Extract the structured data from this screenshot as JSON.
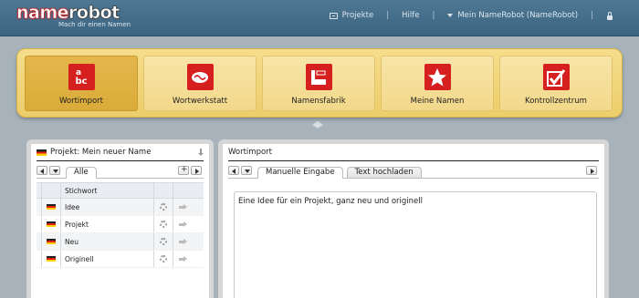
{
  "header": {
    "logo_name": "name",
    "logo_robot": "robot",
    "logo_tagline": "Mach dir einen Namen",
    "nav": [
      {
        "label": "Projekte",
        "icon": "projects-icon"
      },
      {
        "label": "Hilfe"
      },
      {
        "label": "Mein NameRobot (NameRobot)",
        "icon": "caret-down-icon"
      }
    ],
    "lock_icon": "lock-icon"
  },
  "modules": [
    {
      "label": "Wortimport",
      "icon": "abc-icon",
      "active": true,
      "icon_text_1": "a",
      "icon_text_2": "bc"
    },
    {
      "label": "Wortwerkstatt",
      "icon": "workshop-icon",
      "active": false
    },
    {
      "label": "Namensfabrik",
      "icon": "factory-icon",
      "active": false
    },
    {
      "label": "Meine Namen",
      "icon": "star-icon",
      "active": false
    },
    {
      "label": "Kontrollzentrum",
      "icon": "checkmark-icon",
      "active": false
    }
  ],
  "left_panel": {
    "title": "Projekt: Mein neuer Name",
    "tabs": [
      {
        "label": "Alle"
      }
    ],
    "column_header": "Stichwort",
    "rows": [
      {
        "word": "Idee"
      },
      {
        "word": "Projekt"
      },
      {
        "word": "Neu"
      },
      {
        "word": "Originell"
      }
    ]
  },
  "right_panel": {
    "title": "Wortimport",
    "tabs": [
      {
        "label": "Manuelle Eingabe",
        "active": true
      },
      {
        "label": "Text hochladen",
        "active": false
      }
    ],
    "input_text": "Eine Idee für ein Projekt, ganz neu und originell"
  },
  "colors": {
    "topbar": "#3b6482",
    "tray": "#eccd6a",
    "active_tile": "#d9ab39",
    "icon_red": "#d61f1f"
  }
}
